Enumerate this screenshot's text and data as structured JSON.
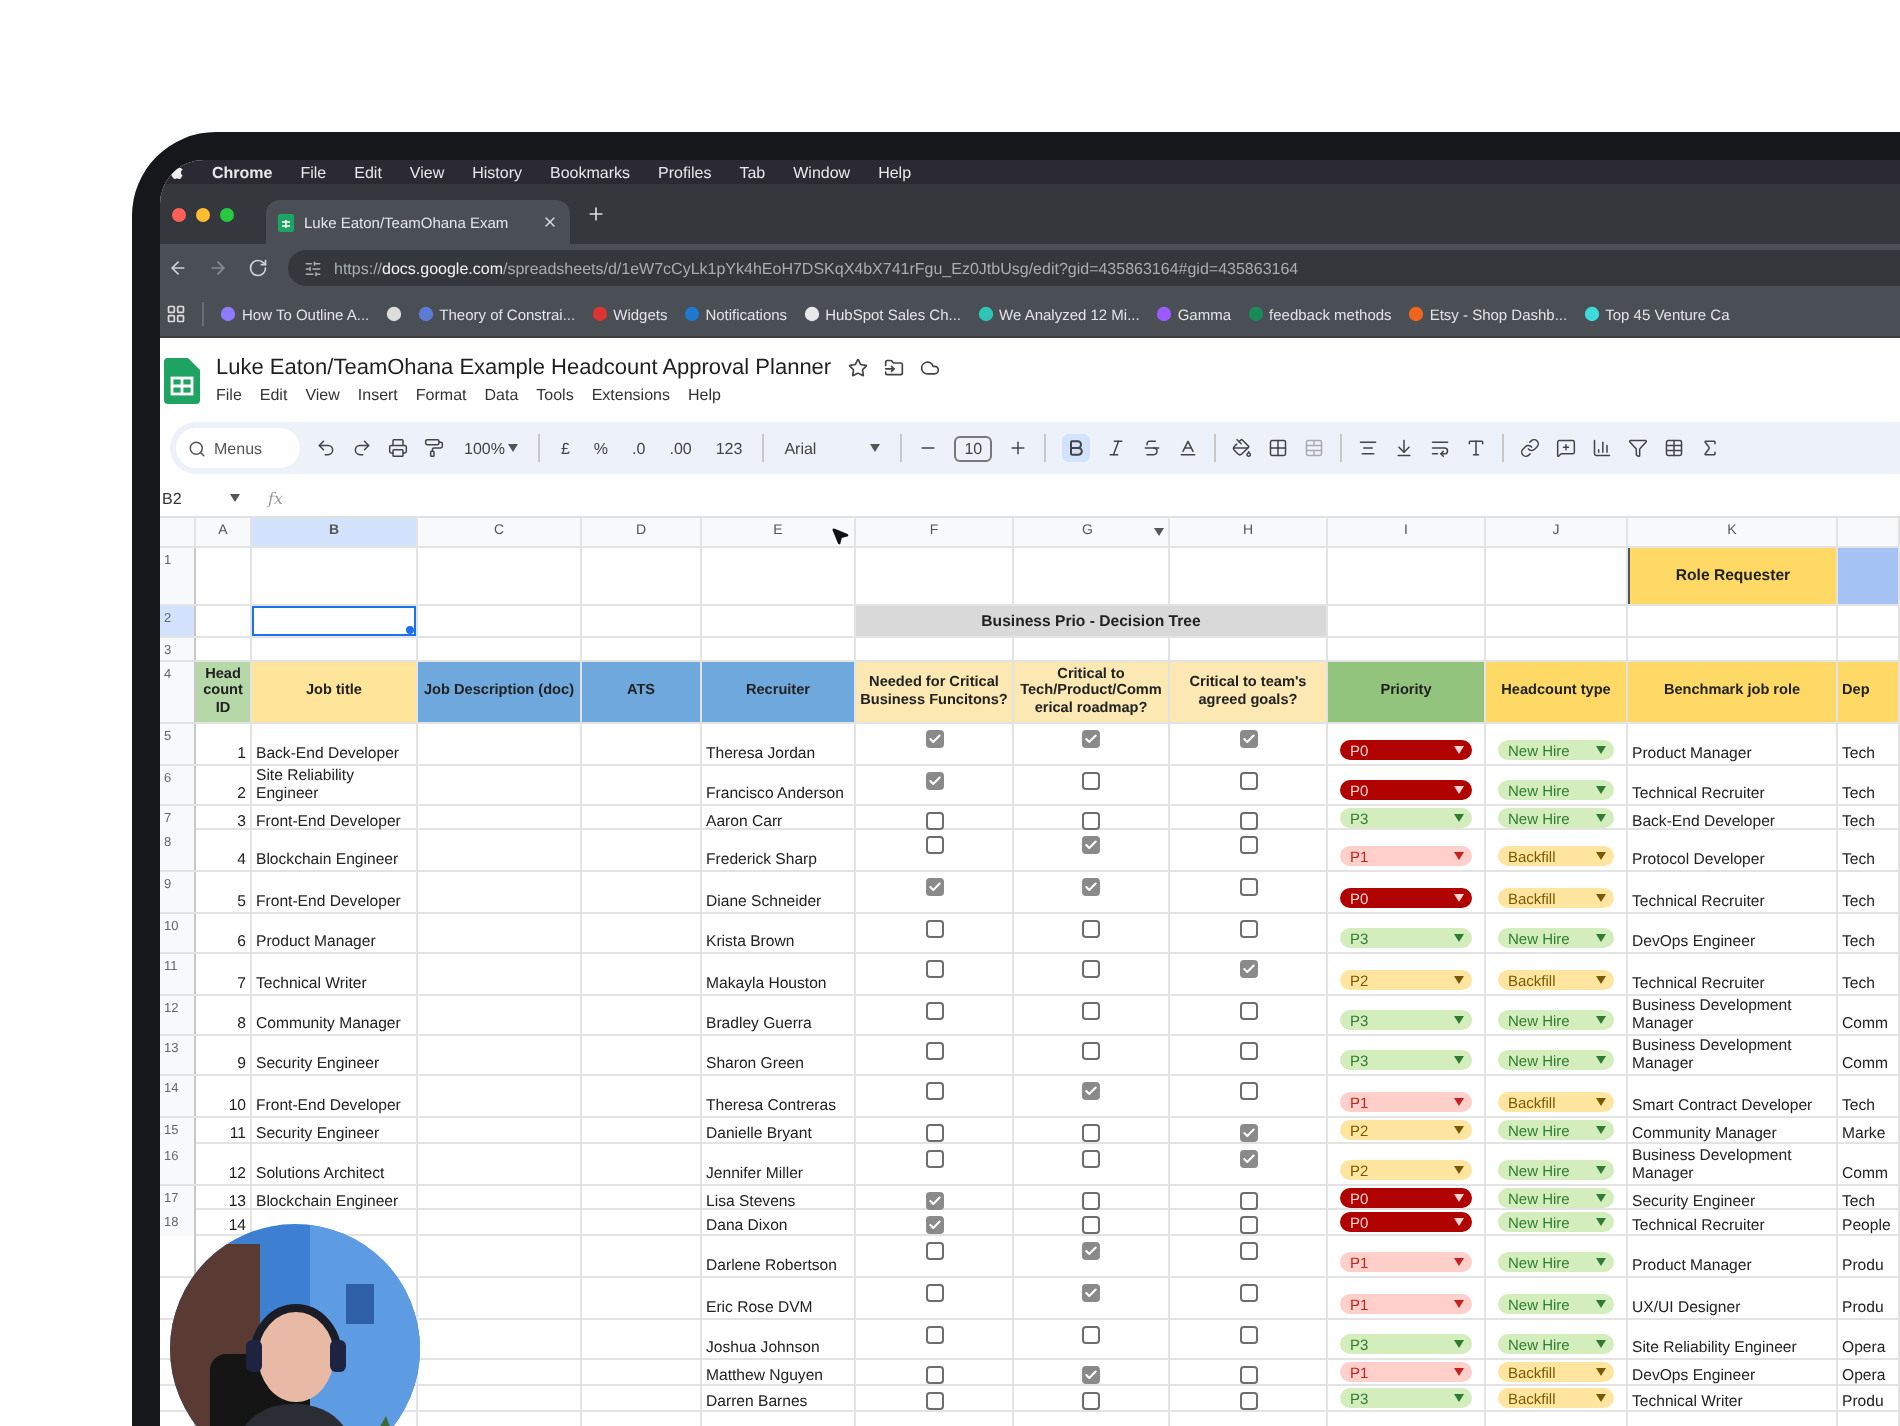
{
  "menubar": {
    "app": "Chrome",
    "items": [
      "File",
      "Edit",
      "View",
      "History",
      "Bookmarks",
      "Profiles",
      "Tab",
      "Window",
      "Help"
    ]
  },
  "browser_tab": {
    "title": "Luke Eaton/TeamOhana Exam"
  },
  "address_bar": {
    "url": "https://**docs.google.com**/spreadsheets/d/1eW7cCyLk1pYk4hEoH7DSKqX4bX741rFgu_Ez0JtbUsg/edit?gid=435863164#gid=435863164"
  },
  "bookmarks": [
    {
      "kind": "labeled",
      "label": "How To Outline A..."
    },
    {
      "kind": "icon"
    },
    {
      "kind": "labeled",
      "label": "Theory of Constrai..."
    },
    {
      "kind": "labeled",
      "label": "Widgets"
    },
    {
      "kind": "labeled",
      "label": "Notifications"
    },
    {
      "kind": "labeled",
      "label": "HubSpot Sales Ch..."
    },
    {
      "kind": "labeled",
      "label": "We Analyzed 12 Mi..."
    },
    {
      "kind": "labeled",
      "label": "Gamma"
    },
    {
      "kind": "labeled",
      "label": "feedback methods"
    },
    {
      "kind": "labeled",
      "label": "Etsy - Shop Dashb..."
    },
    {
      "kind": "labeled",
      "label": "Top 45 Venture Ca"
    }
  ],
  "document": {
    "title": "Luke Eaton/TeamOhana Example Headcount Approval Planner",
    "menus": [
      "File",
      "Edit",
      "View",
      "Insert",
      "Format",
      "Data",
      "Tools",
      "Extensions",
      "Help"
    ]
  },
  "toolbar": {
    "search_placeholder": "Menus",
    "zoom": "100%",
    "currency": "£",
    "percent": "%",
    "decrease_decimal": ".0",
    "increase_decimal": ".00",
    "number_format": "123",
    "font": "Arial",
    "font_size": "10",
    "bold_on": true
  },
  "formula_bar": {
    "cell_ref": "B2",
    "fx": "fx"
  },
  "sheet": {
    "columns": [
      {
        "letter": "A",
        "selected": false
      },
      {
        "letter": "B",
        "selected": true
      },
      {
        "letter": "C",
        "selected": false
      },
      {
        "letter": "D",
        "selected": false
      },
      {
        "letter": "E",
        "selected": false
      },
      {
        "letter": "F",
        "selected": false
      },
      {
        "letter": "G",
        "selected": false
      },
      {
        "letter": "H",
        "selected": false
      },
      {
        "letter": "I",
        "selected": false
      },
      {
        "letter": "J",
        "selected": false
      },
      {
        "letter": "K",
        "selected": false
      }
    ],
    "top_rows": [
      {
        "number": "1",
        "selected": false
      },
      {
        "number": "2",
        "selected": true
      },
      {
        "number": "3",
        "selected": false
      },
      {
        "number": "4",
        "selected": false
      }
    ],
    "role_requester": "Role Requester",
    "decision_tree": "Business Prio - Decision Tree",
    "headers": [
      {
        "label": "Head count ID",
        "color": "#b6d7a8"
      },
      {
        "label": "Job title",
        "color": "#ffe599"
      },
      {
        "label": "Job Description (doc)",
        "color": "#6fa8dc"
      },
      {
        "label": "ATS",
        "color": "#6fa8dc"
      },
      {
        "label": "Recruiter",
        "color": "#6fa8dc"
      },
      {
        "label": "Needed for Critical Business Funcitons?",
        "color": "#fce8b2"
      },
      {
        "label": "Critical to Tech/Product/Commerical roadmap?",
        "color": "#fce8b2"
      },
      {
        "label": "Critical to team's agreed goals?",
        "color": "#fce8b2"
      },
      {
        "label": "Priority",
        "color": "#93c47d"
      },
      {
        "label": "Headcount type",
        "color": "#ffd966"
      },
      {
        "label": "Benchmark job role",
        "color": "#ffd966"
      },
      {
        "label": "Dep",
        "color": "#ffd966"
      }
    ],
    "rows": [
      {
        "number": "5",
        "id": "1",
        "job_title": "Back-End Developer",
        "recruiter": "Theresa Jordan",
        "checks": [
          {
            "checked": true
          },
          {
            "checked": true
          },
          {
            "checked": true
          }
        ],
        "priority": {
          "label": "P0",
          "kind": "critical"
        },
        "headcount_type": {
          "label": "New Hire",
          "kind": "new"
        },
        "benchmark_role": "Product Manager",
        "department": "Tech"
      },
      {
        "number": "6",
        "id": "2",
        "job_title": "Site Reliability Engineer",
        "recruiter": "Francisco Anderson",
        "checks": [
          {
            "checked": true
          },
          {
            "checked": false
          },
          {
            "checked": false
          }
        ],
        "priority": {
          "label": "P0",
          "kind": "critical"
        },
        "headcount_type": {
          "label": "New Hire",
          "kind": "new"
        },
        "benchmark_role": "Technical Recruiter",
        "department": "Tech"
      },
      {
        "number": "7",
        "id": "3",
        "job_title": "Front-End Developer",
        "recruiter": "Aaron Carr",
        "checks": [
          {
            "checked": false
          },
          {
            "checked": false
          },
          {
            "checked": false
          }
        ],
        "priority": {
          "label": "P3",
          "kind": "low"
        },
        "headcount_type": {
          "label": "New Hire",
          "kind": "new"
        },
        "benchmark_role": "Back-End Developer",
        "department": "Tech"
      },
      {
        "number": "8",
        "id": "4",
        "job_title": "Blockchain Engineer",
        "recruiter": "Frederick Sharp",
        "checks": [
          {
            "checked": false
          },
          {
            "checked": true
          },
          {
            "checked": false
          }
        ],
        "priority": {
          "label": "P1",
          "kind": "high"
        },
        "headcount_type": {
          "label": "Backfill",
          "kind": "backfill"
        },
        "benchmark_role": "Protocol Developer",
        "department": "Tech"
      },
      {
        "number": "9",
        "id": "5",
        "job_title": "Front-End Developer",
        "recruiter": "Diane Schneider",
        "checks": [
          {
            "checked": true
          },
          {
            "checked": true
          },
          {
            "checked": false
          }
        ],
        "priority": {
          "label": "P0",
          "kind": "critical"
        },
        "headcount_type": {
          "label": "Backfill",
          "kind": "backfill"
        },
        "benchmark_role": "Technical Recruiter",
        "department": "Tech"
      },
      {
        "number": "10",
        "id": "6",
        "job_title": "Product Manager",
        "recruiter": "Krista Brown",
        "checks": [
          {
            "checked": false
          },
          {
            "checked": false
          },
          {
            "checked": false
          }
        ],
        "priority": {
          "label": "P3",
          "kind": "low"
        },
        "headcount_type": {
          "label": "New Hire",
          "kind": "new"
        },
        "benchmark_role": "DevOps Engineer",
        "department": "Tech"
      },
      {
        "number": "11",
        "id": "7",
        "job_title": "Technical Writer",
        "recruiter": "Makayla Houston",
        "checks": [
          {
            "checked": false
          },
          {
            "checked": false
          },
          {
            "checked": true
          }
        ],
        "priority": {
          "label": "P2",
          "kind": "medium"
        },
        "headcount_type": {
          "label": "Backfill",
          "kind": "backfill"
        },
        "benchmark_role": "Technical Recruiter",
        "department": "Tech"
      },
      {
        "number": "12",
        "id": "8",
        "job_title": "Community Manager",
        "recruiter": "Bradley Guerra",
        "checks": [
          {
            "checked": false
          },
          {
            "checked": false
          },
          {
            "checked": false
          }
        ],
        "priority": {
          "label": "P3",
          "kind": "low"
        },
        "headcount_type": {
          "label": "New Hire",
          "kind": "new"
        },
        "benchmark_role": "Business Development Manager",
        "department": "Comm"
      },
      {
        "number": "13",
        "id": "9",
        "job_title": "Security Engineer",
        "recruiter": "Sharon Green",
        "checks": [
          {
            "checked": false
          },
          {
            "checked": false
          },
          {
            "checked": false
          }
        ],
        "priority": {
          "label": "P3",
          "kind": "low"
        },
        "headcount_type": {
          "label": "New Hire",
          "kind": "new"
        },
        "benchmark_role": "Business Development Manager",
        "department": "Comm"
      },
      {
        "number": "14",
        "id": "10",
        "job_title": "Front-End Developer",
        "recruiter": "Theresa Contreras",
        "checks": [
          {
            "checked": false
          },
          {
            "checked": true
          },
          {
            "checked": false
          }
        ],
        "priority": {
          "label": "P1",
          "kind": "high"
        },
        "headcount_type": {
          "label": "Backfill",
          "kind": "backfill"
        },
        "benchmark_role": "Smart Contract Developer",
        "department": "Tech"
      },
      {
        "number": "15",
        "id": "11",
        "job_title": "Security Engineer",
        "recruiter": "Danielle Bryant",
        "checks": [
          {
            "checked": false
          },
          {
            "checked": false
          },
          {
            "checked": true
          }
        ],
        "priority": {
          "label": "P2",
          "kind": "medium"
        },
        "headcount_type": {
          "label": "New Hire",
          "kind": "new"
        },
        "benchmark_role": "Community Manager",
        "department": "Marke"
      },
      {
        "number": "16",
        "id": "12",
        "job_title": "Solutions Architect",
        "recruiter": "Jennifer Miller",
        "checks": [
          {
            "checked": false
          },
          {
            "checked": false
          },
          {
            "checked": true
          }
        ],
        "priority": {
          "label": "P2",
          "kind": "medium"
        },
        "headcount_type": {
          "label": "New Hire",
          "kind": "new"
        },
        "benchmark_role": "Business Development Manager",
        "department": "Comm"
      },
      {
        "number": "17",
        "id": "13",
        "job_title": "Blockchain Engineer",
        "recruiter": "Lisa Stevens",
        "checks": [
          {
            "checked": true
          },
          {
            "checked": false
          },
          {
            "checked": false
          }
        ],
        "priority": {
          "label": "P0",
          "kind": "critical"
        },
        "headcount_type": {
          "label": "New Hire",
          "kind": "new"
        },
        "benchmark_role": "Security Engineer",
        "department": "Tech"
      },
      {
        "number": "18",
        "id": "14",
        "recruiter": "Dana Dixon",
        "checks": [
          {
            "checked": true
          },
          {
            "checked": false
          },
          {
            "checked": false
          }
        ],
        "priority": {
          "label": "P0",
          "kind": "critical"
        },
        "headcount_type": {
          "label": "New Hire",
          "kind": "new"
        },
        "benchmark_role": "Technical Recruiter",
        "department": "People"
      },
      {
        "recruiter": "Darlene Robertson",
        "checks": [
          {
            "checked": false
          },
          {
            "checked": true
          },
          {
            "checked": false
          }
        ],
        "priority": {
          "label": "P1",
          "kind": "high"
        },
        "headcount_type": {
          "label": "New Hire",
          "kind": "new"
        },
        "benchmark_role": "Product Manager",
        "department": "Produ"
      },
      {
        "recruiter": "Eric Rose DVM",
        "checks": [
          {
            "checked": false
          },
          {
            "checked": true
          },
          {
            "checked": false
          }
        ],
        "priority": {
          "label": "P1",
          "kind": "high"
        },
        "headcount_type": {
          "label": "New Hire",
          "kind": "new"
        },
        "benchmark_role": "UX/UI Designer",
        "department": "Produ"
      },
      {
        "recruiter": "Joshua Johnson",
        "checks": [
          {
            "checked": false
          },
          {
            "checked": false
          },
          {
            "checked": false
          }
        ],
        "priority": {
          "label": "P3",
          "kind": "low"
        },
        "headcount_type": {
          "label": "New Hire",
          "kind": "new"
        },
        "benchmark_role": "Site Reliability Engineer",
        "department": "Opera"
      },
      {
        "recruiter": "Matthew Nguyen",
        "checks": [
          {
            "checked": false
          },
          {
            "checked": true
          },
          {
            "checked": false
          }
        ],
        "priority": {
          "label": "P1",
          "kind": "high"
        },
        "headcount_type": {
          "label": "Backfill",
          "kind": "backfill"
        },
        "benchmark_role": "DevOps Engineer",
        "department": "Opera"
      },
      {
        "recruiter": "Darren Barnes",
        "checks": [
          {
            "checked": false
          },
          {
            "checked": false
          },
          {
            "checked": false
          }
        ],
        "priority": {
          "label": "P3",
          "kind": "low"
        },
        "headcount_type": {
          "label": "Backfill",
          "kind": "backfill"
        },
        "benchmark_role": "Technical Writer",
        "department": "Produ"
      }
    ]
  }
}
